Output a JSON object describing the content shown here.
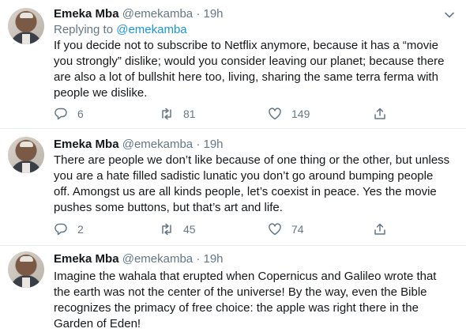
{
  "tweets": [
    {
      "name": "Emeka Mba",
      "handle": "@emekamba",
      "dot": "·",
      "time": "19h",
      "replying_prefix": "Replying to",
      "replying_to": "@emekamba",
      "lines": [
        "If you decide not to subscribe to Netflix anymore, because it has a “movie",
        "you strongly” dislike; would you consider leaving our planet; because there",
        "are also a lot of bullshit here too, living, sharing the same terra ferma with",
        "people we dislike."
      ],
      "replies": "6",
      "retweets": "81",
      "likes": "149"
    },
    {
      "name": "Emeka Mba",
      "handle": "@emekamba",
      "dot": "·",
      "time": "19h",
      "lines": [
        "There are people we don’t like because of one thing or the other, but unless",
        "you are a hate filled sadistic lunatic you don’t go around bumping people",
        "off.  Amongst us are all kinds people, let’s coexist in peace. Yes the movie",
        "pushes some buttons, but that’s art and life."
      ],
      "replies": "2",
      "retweets": "45",
      "likes": "74"
    },
    {
      "name": "Emeka Mba",
      "handle": "@emekamba",
      "dot": "·",
      "time": "19h",
      "lines": [
        "Imagine the wahala that erupted when Copernicus and Galileo wrote that",
        "the earth was not the center of the universe! By the way, even the Bible",
        "recognizes the primacy of free choice:  the apple was right there in the",
        "Garden of Eden!"
      ]
    }
  ],
  "icons": {
    "chevron": "chevron-down-icon",
    "reply": "reply-icon",
    "retweet": "retweet-icon",
    "like": "heart-icon",
    "share": "share-icon"
  },
  "colors": {
    "link": "#1b95e0",
    "secondary_text": "#657786",
    "divider": "#e6ecf0"
  }
}
